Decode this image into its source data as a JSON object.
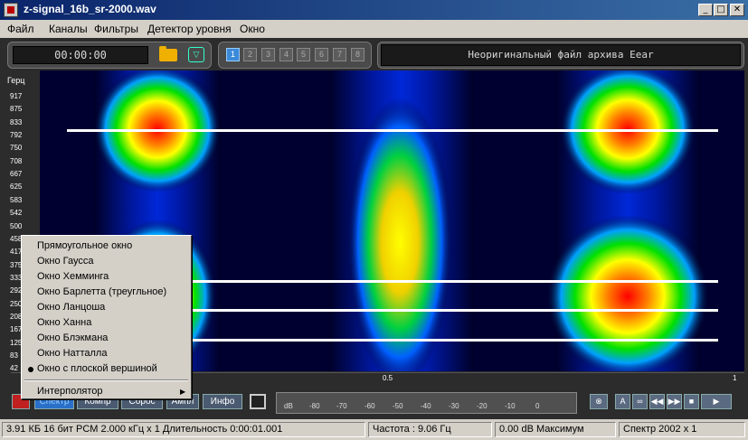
{
  "window": {
    "title": "z-signal_16b_sr-2000.wav",
    "controls": [
      "minimize-icon",
      "maximize-icon",
      "close-icon"
    ]
  },
  "menu": [
    "Файл",
    "Каналы",
    "Фильтры",
    "Детектор уровня",
    "Окно"
  ],
  "toolbar": {
    "time": "00:00:00",
    "channels": [
      "1",
      "2",
      "3",
      "4",
      "5",
      "6",
      "7",
      "8"
    ],
    "active_channel": "1",
    "info_text": "Неоригинальный файл архива Eear"
  },
  "spectrogram": {
    "y_title": "Герц",
    "y_ticks": [
      "917",
      "875",
      "833",
      "792",
      "750",
      "708",
      "667",
      "625",
      "583",
      "542",
      "500",
      "458",
      "417",
      "375",
      "333",
      "292",
      "250",
      "208",
      "167",
      "125",
      "83",
      "42"
    ],
    "x_ticks": [
      "0.5",
      "1"
    ]
  },
  "context_menu": {
    "items": [
      "Прямоугольное окно",
      "Окно Гаусса",
      "Окно Хемминга",
      "Окно Барлетта (треугльное)",
      "Окно Ланцоша",
      "Окно Ханна",
      "Окно Блэкмана",
      "Окно Натталла",
      "Окно с плоской вершиной"
    ],
    "selected_index": 8,
    "submenu": "Интерполятор"
  },
  "bottom_toolbar": {
    "buttons": [
      "Спектр",
      "Компр",
      "Сброс",
      "Ампл",
      "Инфо"
    ],
    "active_button": "Спектр",
    "meter_labels": [
      "dB",
      "-80",
      "-70",
      "-60",
      "-50",
      "-40",
      "-30",
      "-20",
      "-10",
      "0"
    ],
    "transport": [
      "A",
      "∞",
      "◀◀",
      "▶▶",
      "■",
      "▶"
    ]
  },
  "status": {
    "format": "3.91 КБ 16 бит PCM 2.000 кГц x 1  Длительность 0:00:01.001",
    "frequency": "Частота : 9.06 Гц",
    "level": "0.00 dB Максимум",
    "spectrum": "Спектр 2002 x 1"
  },
  "colors": {
    "title_bar": "#0a246a",
    "spectro_bg": "#000028",
    "accent": "#3a8ad8"
  }
}
